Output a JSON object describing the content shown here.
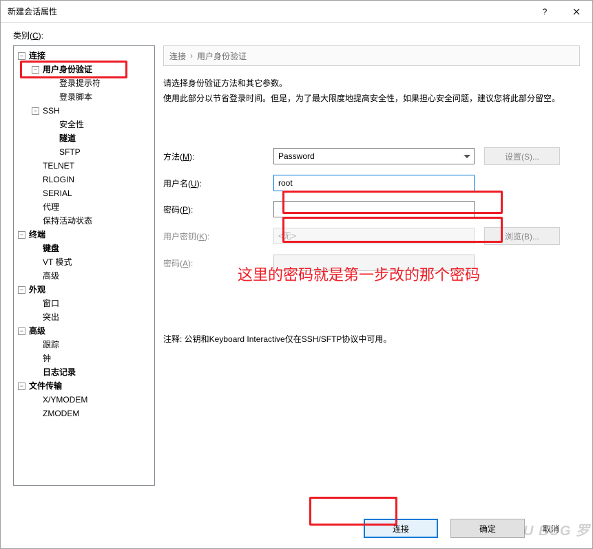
{
  "window": {
    "title": "新建会话属性"
  },
  "category_label_pre": "类别(",
  "category_label_key": "C",
  "category_label_post": "):",
  "tree": {
    "connection": "连接",
    "auth": "用户身份验证",
    "login_prompt": "登录提示符",
    "login_script": "登录脚本",
    "ssh": "SSH",
    "security": "安全性",
    "tunnel": "隧道",
    "sftp": "SFTP",
    "telnet": "TELNET",
    "rlogin": "RLOGIN",
    "serial": "SERIAL",
    "proxy": "代理",
    "keepalive": "保持活动状态",
    "terminal": "终端",
    "keyboard": "键盘",
    "vtmode": "VT 模式",
    "advanced_t": "高级",
    "appearance": "外观",
    "window": "窗口",
    "highlight": "突出",
    "advanced": "高级",
    "trace": "跟踪",
    "bell": "钟",
    "logging": "日志记录",
    "filetransfer": "文件传输",
    "xy": "X/YMODEM",
    "z": "ZMODEM"
  },
  "breadcrumb": {
    "root": "连接",
    "leaf": "用户身份验证"
  },
  "desc_line1": "请选择身份验证方法和其它参数。",
  "desc_line2": "使用此部分以节省登录时间。但是，为了最大限度地提高安全性，如果担心安全问题，建议您将此部分留空。",
  "form": {
    "method_label_pre": "方法(",
    "method_key": "M",
    "method_label_post": "):",
    "method_value": "Password",
    "user_label_pre": "用户名(",
    "user_key": "U",
    "user_label_post": "):",
    "user_value": "root",
    "pass_label_pre": "密码(",
    "pass_key": "P",
    "pass_label_post": "):",
    "pass_value": "",
    "ukey_label_pre": "用户密钥(",
    "ukey_key": "K",
    "ukey_label_post": "):",
    "ukey_value": "<无>",
    "pass2_label_pre": "密码(",
    "pass2_key": "A",
    "pass2_label_post": "):",
    "settings_btn": "设置(S)...",
    "browse_btn": "浏览(B)..."
  },
  "note": "注释: 公钥和Keyboard Interactive仅在SSH/SFTP协议中可用。",
  "annotation": "这里的密码就是第一步改的那个密码",
  "footer": {
    "connect": "连接",
    "ok": "确定",
    "cancel": "取消"
  },
  "watermark": "U BUG 罗"
}
